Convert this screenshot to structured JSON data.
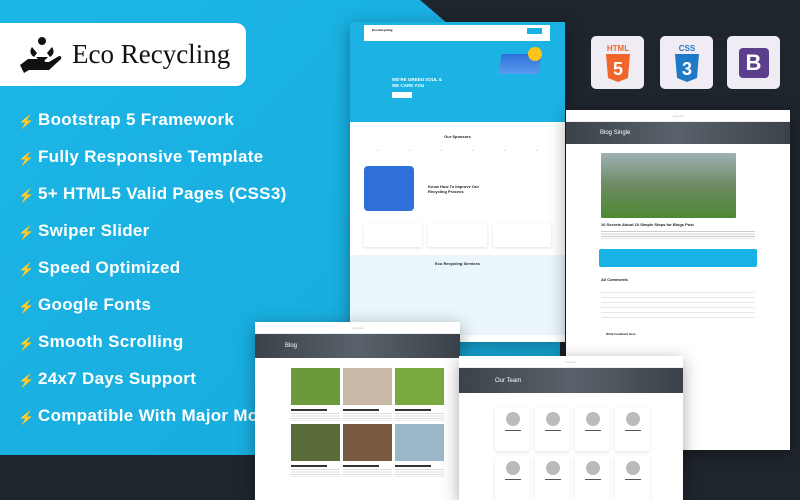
{
  "brand": {
    "name": "Eco Recycling",
    "icon": "hand-recycle-icon"
  },
  "features": [
    "Bootstrap 5 Framework",
    "Fully Responsive Template",
    "5+ HTML5 Valid Pages (CSS3)",
    "Swiper Slider",
    "Speed Optimized",
    "Google Fonts",
    "Smooth Scrolling",
    "24x7 Days Support",
    "Compatible With Major Modern Browsers"
  ],
  "tech_badges": [
    {
      "label": "HTML",
      "num": "5",
      "color": "#f0652a"
    },
    {
      "label": "CSS",
      "num": "3",
      "color": "#2079c7"
    },
    {
      "label": "B",
      "color": "#5b3e8c"
    }
  ],
  "home": {
    "logo": "Eco Recycling",
    "hero_line1": "WE'RE GREEN SOUL &",
    "hero_line2": "WE CARE YOU",
    "sponsors_title": "Our Sponsors",
    "process_title": "Know How To Improve Our Recycling Process",
    "services_title": "Eco Recycling Services"
  },
  "blog": {
    "title": "Blog"
  },
  "blog_single": {
    "title": "Blog Single",
    "post_title": "10 Secrets About 10 Simple Steps for Blogs Post",
    "comments_title": "All Comments",
    "feedback_title": "Write Feedback Here"
  },
  "team": {
    "title": "Our Team"
  },
  "colors": {
    "accent": "#19b2e4",
    "dark": "#1f252d"
  }
}
